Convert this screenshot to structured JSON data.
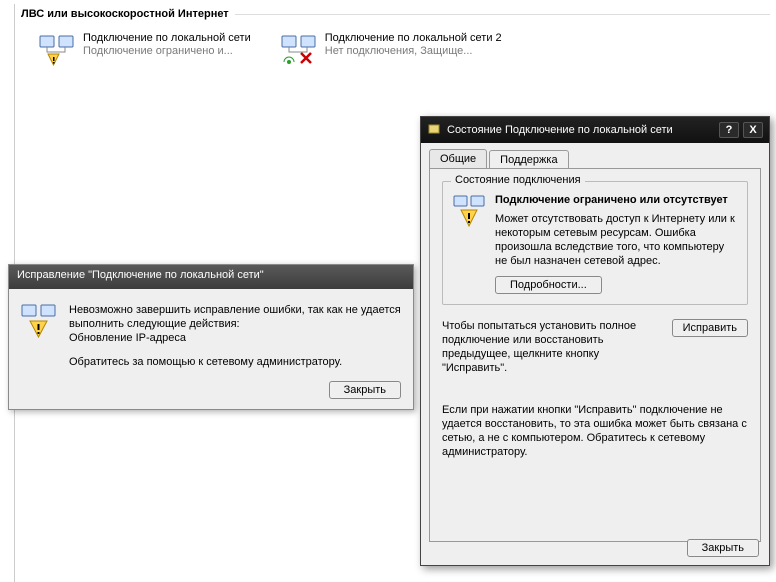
{
  "section_header": "ЛВС или высокоскоростной Интернет",
  "connections": [
    {
      "name": "Подключение по локальной сети",
      "status": "Подключение ограничено и..."
    },
    {
      "name": "Подключение по локальной сети 2",
      "status": "Нет подключения, Защище..."
    }
  ],
  "repair_dialog": {
    "title": "Исправление \"Подключение по локальной сети\"",
    "line1": "Невозможно завершить исправление ошибки, так как не удается выполнить следующие действия:",
    "line2": "Обновление IP-адреса",
    "line3": "Обратитесь за помощью к сетевому администратору.",
    "close_btn": "Закрыть"
  },
  "status_window": {
    "title": "Состояние Подключение по локальной сети",
    "help_glyph": "?",
    "close_glyph": "X",
    "tab_general": "Общие",
    "tab_support": "Поддержка",
    "group_label": "Состояние подключения",
    "warn_title": "Подключение ограничено или отсутствует",
    "warn_desc": "Может отсутствовать доступ к Интернету или к некоторым сетевым ресурсам. Ошибка произошла вследствие того, что компьютеру не был назначен сетевой адрес.",
    "details_btn": "Подробности...",
    "repair_hint": "Чтобы попытаться установить полное подключение или восстановить предыдущее, щелкните кнопку \"Исправить\".",
    "repair_btn": "Исправить",
    "footer_text": "Если при нажатии кнопки \"Исправить\" подключение не удается восстановить, то эта ошибка может быть связана с сетью, а не с компьютером.  Обратитесь к сетевому администратору.",
    "close_btn": "Закрыть"
  }
}
